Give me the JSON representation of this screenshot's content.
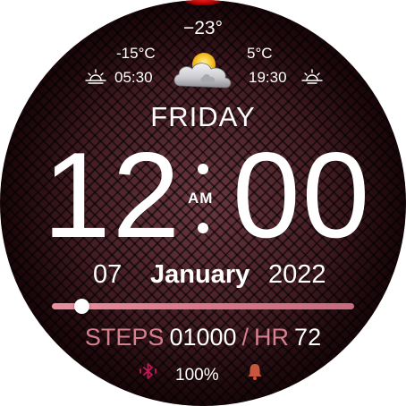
{
  "weather": {
    "current_temp": "−23°",
    "min_temp": "-15°C",
    "max_temp": "5°C",
    "sunrise_time": "05:30",
    "sunset_time": "19:30",
    "condition_icon": "partly-cloudy-icon"
  },
  "time": {
    "day_of_week": "FRIDAY",
    "hour": "12",
    "minute": "00",
    "ampm": "AM"
  },
  "date": {
    "day": "07",
    "month": "January",
    "year": "2022"
  },
  "progress": {
    "fraction": 0.1
  },
  "stats": {
    "steps_label": "STEPS",
    "steps_value": "01000",
    "separator": "/",
    "hr_label": "HR",
    "hr_value": "72"
  },
  "status": {
    "battery": "100%",
    "bluetooth_icon": "bluetooth-icon",
    "alarm_icon": "bell-icon"
  },
  "colors": {
    "accent": "#d4808e",
    "background": "#3a1419",
    "text": "#ffffff"
  }
}
